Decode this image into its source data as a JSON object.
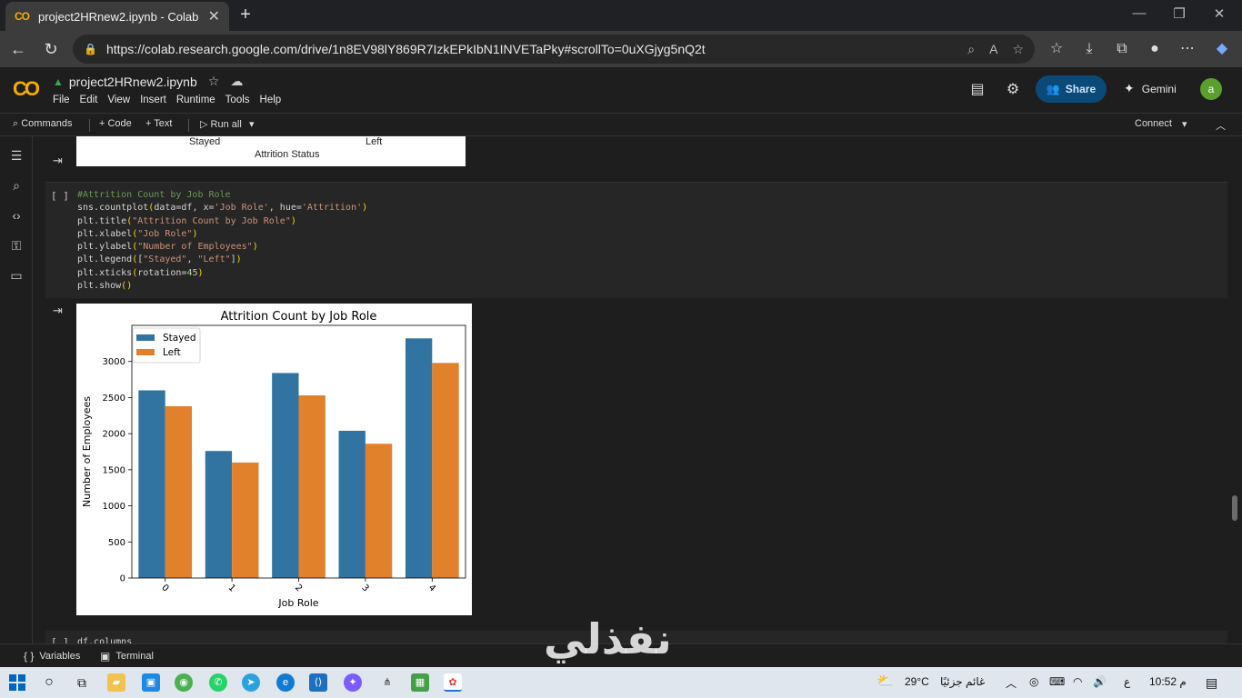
{
  "browser": {
    "tab_title": "project2HRnew2.ipynb - Colab",
    "url": "https://colab.research.google.com/drive/1n8EV98lY869R7IzkEPkIbN1INVETaPky#scrollTo=0uXGjyg5nQ2t"
  },
  "colab": {
    "notebook_title": "project2HRnew2.ipynb",
    "menu": [
      "File",
      "Edit",
      "View",
      "Insert",
      "Runtime",
      "Tools",
      "Help"
    ],
    "share_label": "Share",
    "gemini_label": "Gemini",
    "avatar_letter": "a",
    "toolbar": {
      "commands": "Commands",
      "add_code": "+ Code",
      "add_text": "+ Text",
      "run_all": "Run all",
      "connect": "Connect"
    }
  },
  "prev_output": {
    "tick_stayed": "Stayed",
    "tick_left": "Left",
    "xlabel": "Attrition Status"
  },
  "cell": {
    "run_brackets": "[ ]",
    "lines": [
      "#Attrition Count by Job Role",
      "sns.countplot(data=df, x='Job Role', hue='Attrition')",
      "plt.title(\"Attrition Count by Job Role\")",
      "plt.xlabel(\"Job Role\")",
      "plt.ylabel(\"Number of Employees\")",
      "plt.legend([\"Stayed\", \"Left\"])",
      "plt.xticks(rotation=45)",
      "plt.show()"
    ]
  },
  "next_cell": {
    "run_brackets": "[ ]",
    "code": "df.columns"
  },
  "chart_data": {
    "type": "bar",
    "title": "Attrition Count by Job Role",
    "xlabel": "Job Role",
    "ylabel": "Number of Employees",
    "categories": [
      "0",
      "1",
      "2",
      "3",
      "4"
    ],
    "series": [
      {
        "name": "Stayed",
        "color": "#3274a1",
        "values": [
          2600,
          1760,
          2840,
          2040,
          3320
        ]
      },
      {
        "name": "Left",
        "color": "#e1812c",
        "values": [
          2380,
          1600,
          2530,
          1860,
          2980
        ]
      }
    ],
    "ylim": [
      0,
      3500
    ],
    "yticks": [
      0,
      500,
      1000,
      1500,
      2000,
      2500,
      3000
    ],
    "xtick_rotation": 45,
    "legend": "upper-left",
    "grid": false
  },
  "statusbar": {
    "variables": "Variables",
    "terminal": "Terminal"
  },
  "watermark": "نفذلي",
  "taskbar": {
    "weather": "29°C",
    "weather_text": "غائم جزئيًا",
    "lang": "ع",
    "time": "10:52 م"
  }
}
